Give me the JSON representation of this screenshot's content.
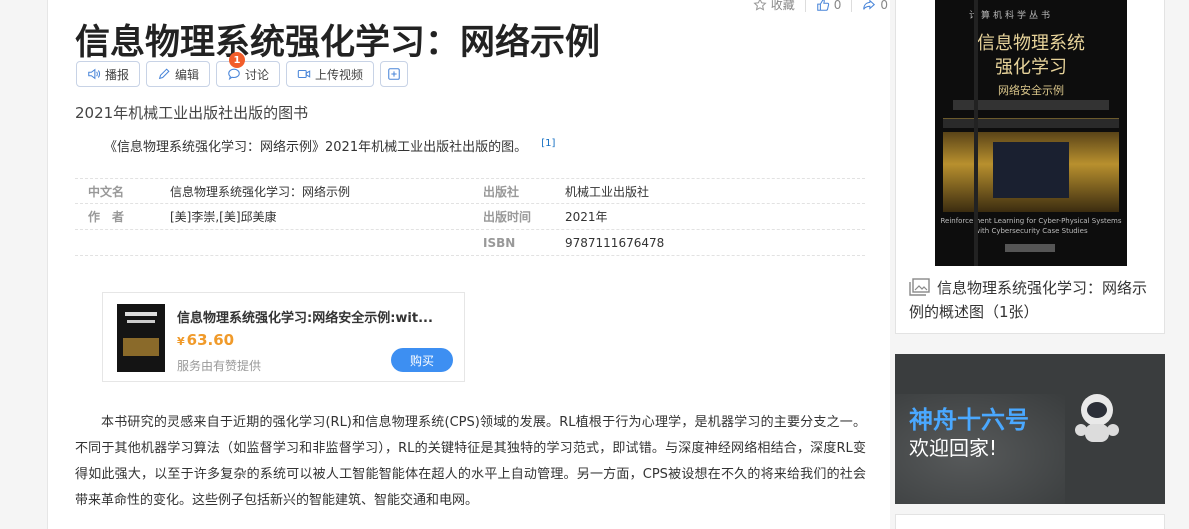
{
  "title": "信息物理系统强化学习：网络示例",
  "top_actions": {
    "favorite_label": "收藏",
    "like_count": "0",
    "share_count": "0"
  },
  "toolbar": {
    "play_label": "播报",
    "edit_label": "编辑",
    "discuss_label": "讨论",
    "discuss_badge": "1",
    "upload_label": "上传视频"
  },
  "subtitle": "2021年机械工业出版社出版的图书",
  "intro": {
    "text": "《信息物理系统强化学习：网络示例》2021年机械工业出版社出版的图。",
    "ref": "[1]"
  },
  "info": {
    "rows": [
      {
        "k1": "中文名",
        "v1": "信息物理系统强化学习：网络示例",
        "k2": "出版社",
        "v2": "机械工业出版社"
      },
      {
        "k1": "作　者",
        "v1": "[美]李崇,[美]邱美康",
        "k2": "出版时间",
        "v2": "2021年"
      },
      {
        "k1": "",
        "v1": "",
        "k2": "ISBN",
        "v2": "9787111676478"
      }
    ]
  },
  "buy": {
    "title": "信息物理系统强化学习:网络安全示例:wit...",
    "currency": "¥",
    "price": "63.60",
    "note": "服务由有赞提供",
    "button": "购买"
  },
  "body_text": "本书研究的灵感来自于近期的强化学习(RL)和信息物理系统(CPS)领域的发展。RL植根于行为心理学，是机器学习的主要分支之一。不同于其他机器学习算法（如监督学习和非监督学习），RL的关键特征是其独特的学习范式，即试错。与深度神经网络相结合，深度RL变得如此强大，以至于许多复杂的系统可以被人工智能智能体在超人的水平上自动管理。另一方面，CPS被设想在不久的将来给我们的社会带来革命性的变化。这些例子包括新兴的智能建筑、智能交通和电网。",
  "album": {
    "cover": {
      "series": "计算机科学丛书",
      "title_line1": "信息物理系统",
      "title_line2": "强化学习",
      "subtitle": "网络安全示例",
      "english_title": "Reinforcement Learning for Cyber-Physical Systems",
      "english_sub": "with Cybersecurity Case Studies"
    },
    "caption": "信息物理系统强化学习：网络示例的概述图（1张）"
  },
  "ad": {
    "line1": "神舟十六号",
    "line2": "欢迎回家!"
  }
}
